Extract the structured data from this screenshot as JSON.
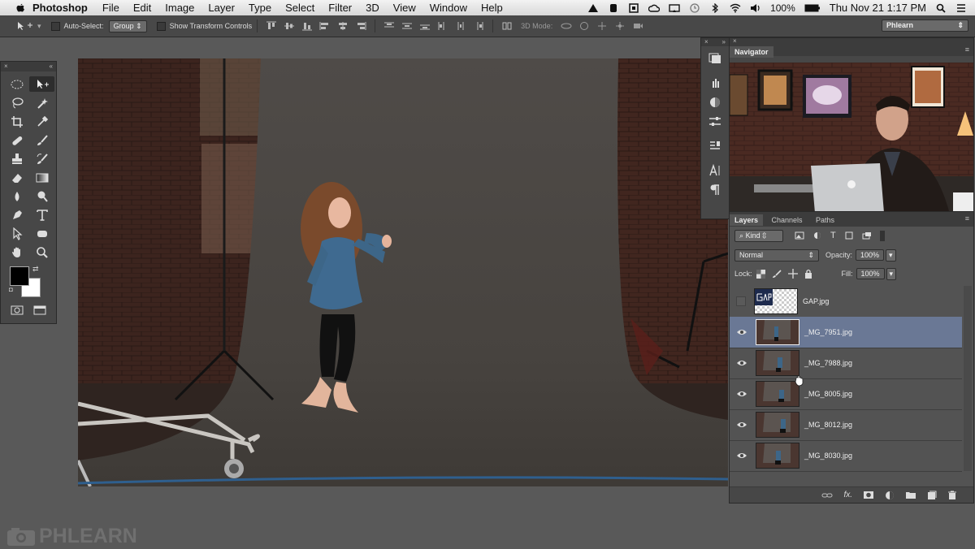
{
  "menubar": {
    "app_name": "Photoshop",
    "items": [
      "File",
      "Edit",
      "Image",
      "Layer",
      "Type",
      "Select",
      "Filter",
      "3D",
      "View",
      "Window",
      "Help"
    ],
    "battery": "100%",
    "datetime": "Thu Nov 21  1:17 PM"
  },
  "options": {
    "auto_select_label": "Auto-Select:",
    "auto_select_value": "Group",
    "transform_label": "Show Transform Controls",
    "mode3d_label": "3D Mode:",
    "workspace": "Phlearn"
  },
  "navigator": {
    "title": "Navigator"
  },
  "layers_panel": {
    "tabs": [
      "Layers",
      "Channels",
      "Paths"
    ],
    "kind_label": "Kind",
    "blend_mode": "Normal",
    "opacity_label": "Opacity:",
    "opacity_value": "100%",
    "lock_label": "Lock:",
    "fill_label": "Fill:",
    "fill_value": "100%",
    "layers": [
      {
        "name": "GAP.jpg",
        "visible": false,
        "selected": false
      },
      {
        "name": "_MG_7951.jpg",
        "visible": true,
        "selected": true
      },
      {
        "name": "_MG_7988.jpg",
        "visible": true,
        "selected": false
      },
      {
        "name": "_MG_8005.jpg",
        "visible": true,
        "selected": false
      },
      {
        "name": "_MG_8012.jpg",
        "visible": true,
        "selected": false
      },
      {
        "name": "_MG_8030.jpg",
        "visible": true,
        "selected": false
      }
    ]
  },
  "watermark": "PHLEARN",
  "colors": {
    "selection": "#6a7895",
    "panel": "#474747",
    "menubar": "#e6e6e6"
  }
}
